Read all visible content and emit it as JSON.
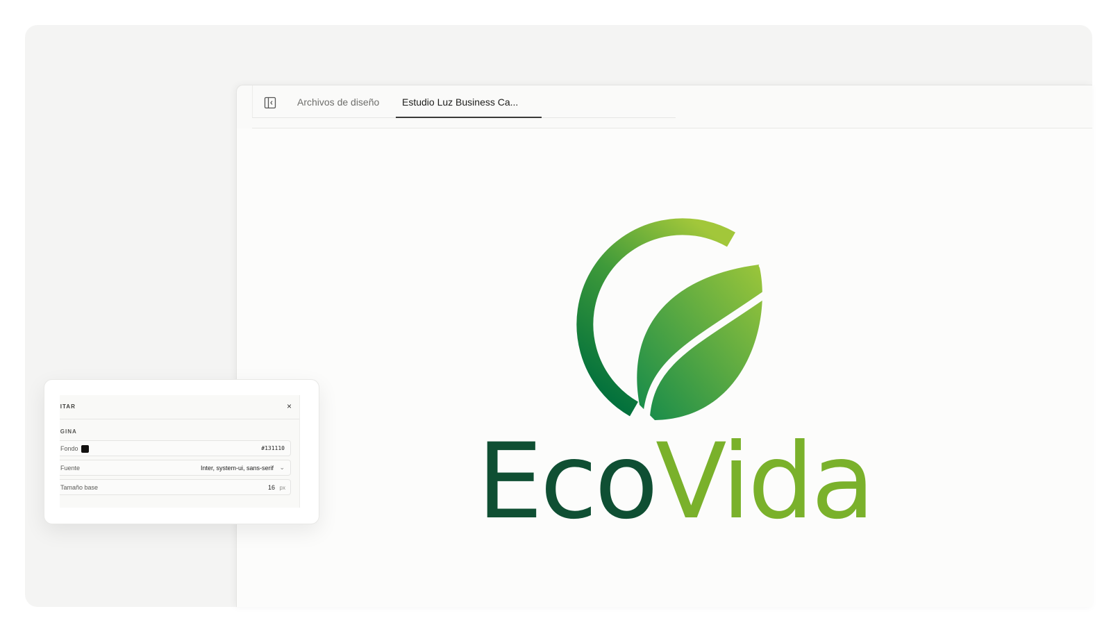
{
  "tabs": {
    "files_label": "Archivos de diseño",
    "active_label": "Estudio Luz Business Ca..."
  },
  "icons": {
    "sidebar_toggle": "sidebar-panel-icon",
    "close": "close-icon",
    "chevron": "chevron-down-icon"
  },
  "logo": {
    "word_eco": "Eco",
    "word_vida": "Vida",
    "colors": {
      "dark_green": "#0f4f33",
      "mid_green": "#138a4b",
      "light_green": "#7ab12b",
      "lime": "#a2c73a"
    }
  },
  "panel": {
    "title": "DITAR",
    "section": "ÁGINA",
    "close_label": "×",
    "fields": {
      "background_label": "Fondo",
      "background_value": "#131110",
      "font_label": "Fuente",
      "font_value": "Inter, system-ui, sans-serif",
      "chevron_glyph": "⌄",
      "size_label": "Tamaño base",
      "size_value": "16",
      "size_unit": "px"
    }
  }
}
